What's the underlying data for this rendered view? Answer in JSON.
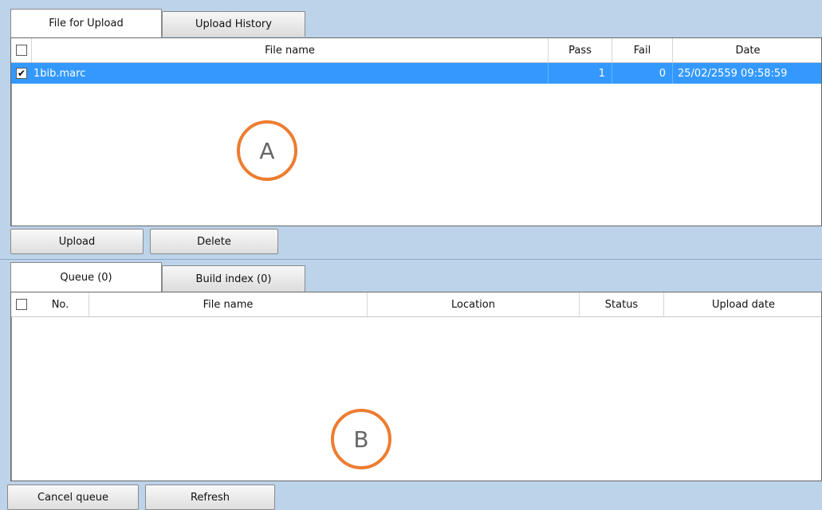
{
  "upload_panel": {
    "tabs": [
      {
        "label": "File for Upload",
        "active": true
      },
      {
        "label": "Upload History",
        "active": false
      }
    ],
    "grid": {
      "columns": [
        "",
        "File name",
        "Pass",
        "Fail",
        "Date"
      ],
      "rows": [
        {
          "checked": true,
          "file_name": "1bib.marc",
          "pass": "1",
          "fail": "0",
          "date": "25/02/2559 09:58:59",
          "selected": true
        }
      ]
    },
    "buttons": {
      "upload": "Upload",
      "delete": "Delete"
    },
    "marker": "A"
  },
  "queue_panel": {
    "tabs": [
      {
        "label": "Queue (0)",
        "active": true
      },
      {
        "label": "Build index (0)",
        "active": false
      }
    ],
    "grid": {
      "columns": [
        "",
        "No.",
        "File name",
        "Location",
        "Status",
        "Upload date"
      ],
      "rows": []
    },
    "buttons": {
      "cancel_queue": "Cancel queue",
      "refresh": "Refresh"
    },
    "marker": "B"
  },
  "colors": {
    "background": "#bcd3ea",
    "selection": "#3399ff",
    "marker": "#ed7d31"
  }
}
